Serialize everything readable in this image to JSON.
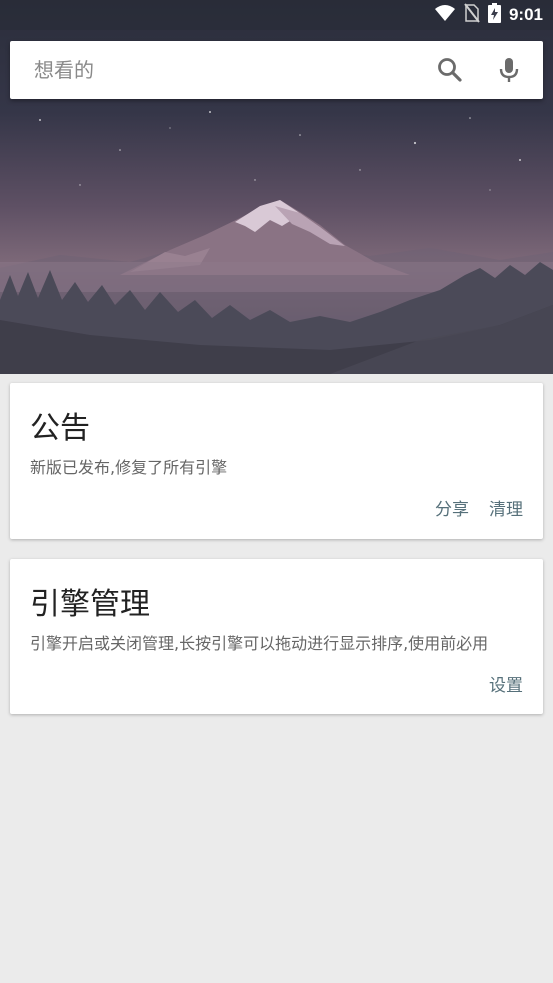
{
  "status_bar": {
    "time": "9:01",
    "icons": [
      "wifi-icon",
      "no-sim-icon",
      "battery-charging-icon"
    ]
  },
  "search": {
    "placeholder": "想看的",
    "search_icon": "search-icon",
    "mic_icon": "mic-icon"
  },
  "hero": {
    "image": "mountain-landscape-night"
  },
  "cards": [
    {
      "title": "公告",
      "description": "新版已发布,修复了所有引擎",
      "actions": [
        "分享",
        "清理"
      ]
    },
    {
      "title": "引擎管理",
      "description": "引擎开启或关闭管理,长按引擎可以拖动进行显示排序,使用前必用",
      "actions": [
        "设置"
      ]
    }
  ],
  "colors": {
    "background": "#ebebeb",
    "card": "#ffffff",
    "action_text": "#56707a",
    "title_text": "#222222"
  }
}
